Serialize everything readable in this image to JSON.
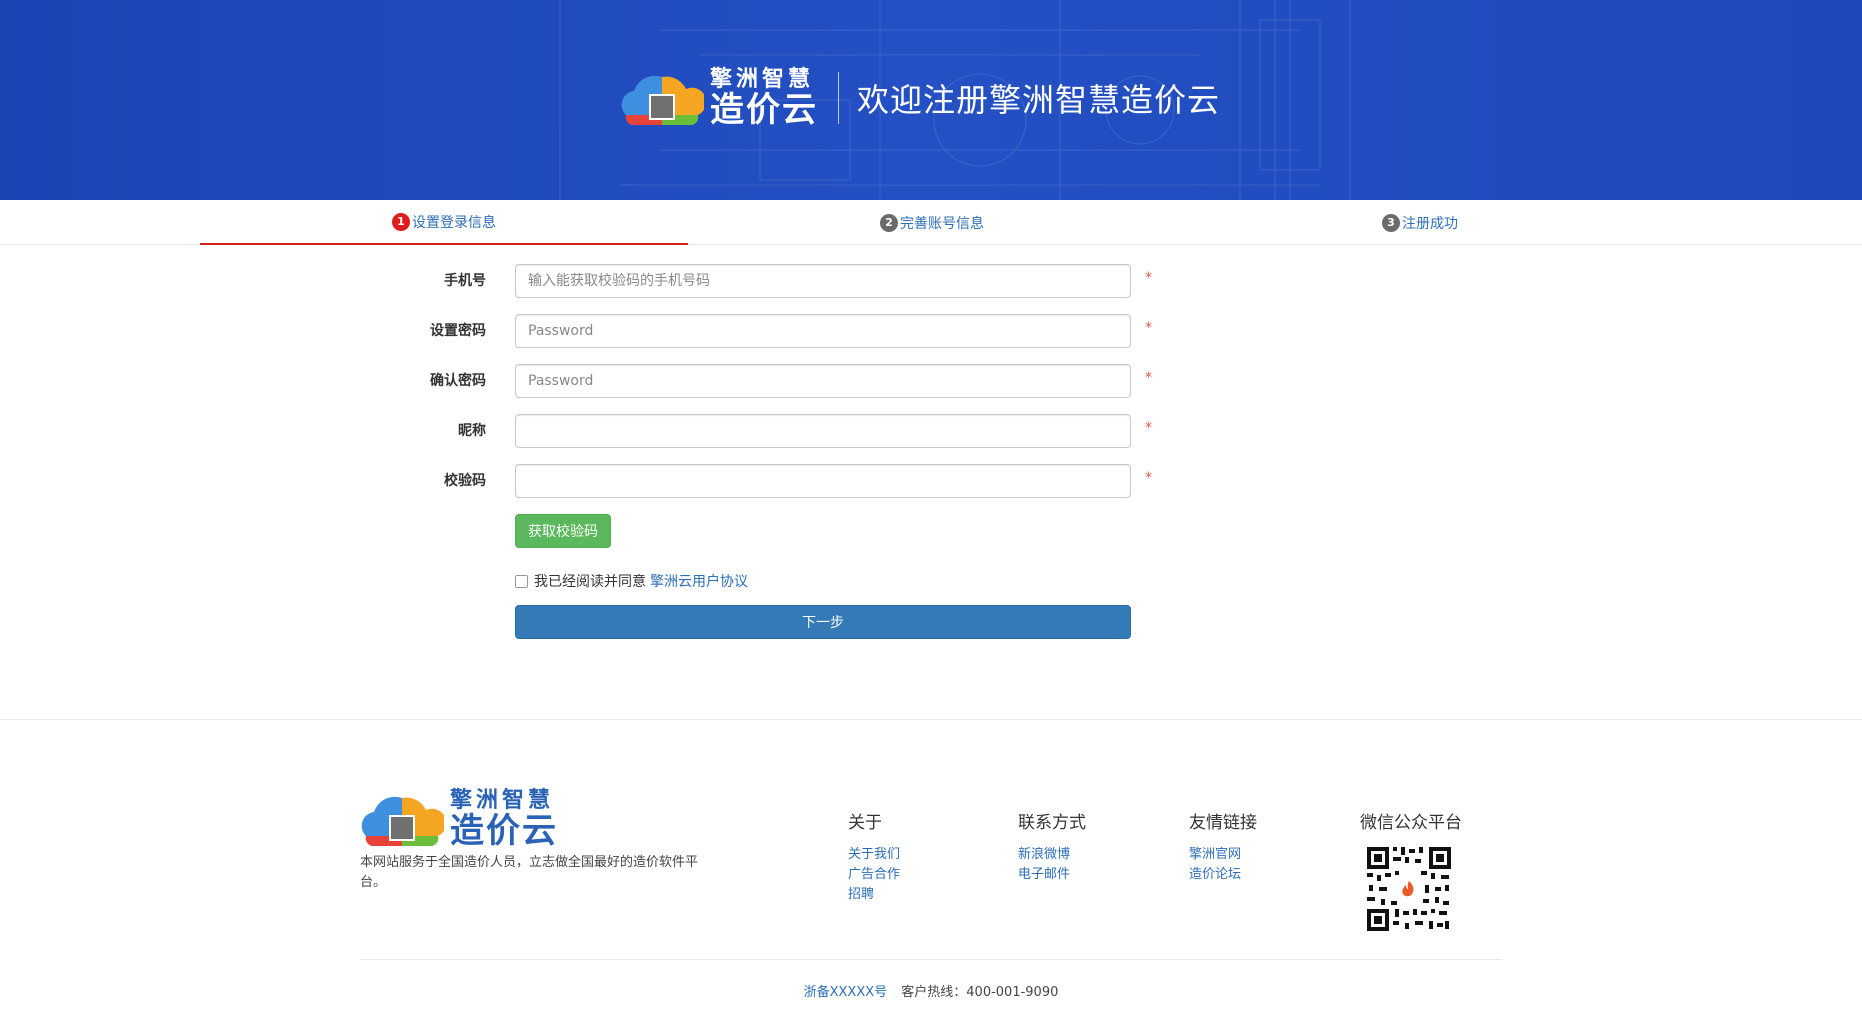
{
  "banner": {
    "logo": {
      "line1": "擎洲智慧",
      "line2": "造价云"
    },
    "title": "欢迎注册擎洲智慧造价云",
    "background_color": "#1f48b9"
  },
  "steps": [
    {
      "num": "1",
      "label": "设置登录信息",
      "active": true
    },
    {
      "num": "2",
      "label": "完善账号信息",
      "active": false
    },
    {
      "num": "3",
      "label": "注册成功",
      "active": false
    }
  ],
  "form": {
    "phone": {
      "label": "手机号",
      "placeholder": "输入能获取校验码的手机号码",
      "value": ""
    },
    "password": {
      "label": "设置密码",
      "placeholder": "Password",
      "value": ""
    },
    "confirm": {
      "label": "确认密码",
      "placeholder": "Password",
      "value": ""
    },
    "nickname": {
      "label": "昵称",
      "placeholder": "",
      "value": ""
    },
    "code": {
      "label": "校验码",
      "placeholder": "",
      "value": ""
    },
    "required_mark": "*",
    "get_code_button": "获取校验码",
    "agree_text": "我已经阅读并同意",
    "agree_link": "擎洲云用户协议",
    "agree_checked": false,
    "next_button": "下一步"
  },
  "footer": {
    "logo": {
      "line1": "擎洲智慧",
      "line2": "造价云"
    },
    "description": "本网站服务于全国造价人员，立志做全国最好的造价软件平台。",
    "columns": [
      {
        "title": "关于",
        "links": [
          "关于我们",
          "广告合作",
          "招聘"
        ]
      },
      {
        "title": "联系方式",
        "links": [
          "新浪微博",
          "电子邮件"
        ]
      },
      {
        "title": "友情链接",
        "links": [
          "擎洲官网",
          "造价论坛"
        ]
      },
      {
        "title": "微信公众平台",
        "links": []
      }
    ],
    "icp": "浙备XXXXX号",
    "hotline": "客户热线：400-001-9090"
  },
  "colors": {
    "accent_blue": "#337ab7",
    "green_button": "#5cb85c",
    "active_step": "#e01b1b",
    "link": "#2c6fb8"
  }
}
